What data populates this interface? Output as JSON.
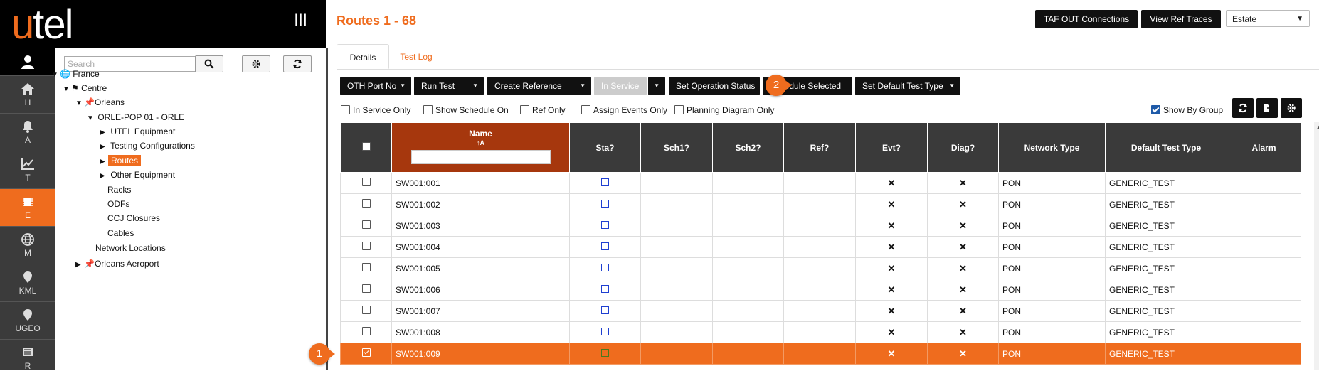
{
  "app": {
    "logo_u": "u",
    "logo_rest": "tel"
  },
  "nav": {
    "items": [
      {
        "label": "H",
        "icon": "home-icon"
      },
      {
        "label": "A",
        "icon": "bell-icon"
      },
      {
        "label": "T",
        "icon": "chart-icon"
      },
      {
        "label": "E",
        "icon": "chip-icon",
        "active": true
      },
      {
        "label": "M",
        "icon": "globe-icon"
      },
      {
        "label": "KML",
        "icon": "map-pin-icon"
      },
      {
        "label": "UGEO",
        "icon": "map-pin-icon"
      },
      {
        "label": "R",
        "icon": "report-icon"
      }
    ]
  },
  "tree": {
    "search_placeholder": "Search",
    "nodes": [
      {
        "label": "France"
      },
      {
        "label": "Centre"
      },
      {
        "label": "Orleans"
      },
      {
        "label": "ORLE-POP 01 - ORLE"
      },
      {
        "label": "UTEL Equipment"
      },
      {
        "label": "Testing Configurations"
      },
      {
        "label": "Routes"
      },
      {
        "label": "Other Equipment"
      },
      {
        "label": "Racks"
      },
      {
        "label": "ODFs"
      },
      {
        "label": "CCJ Closures"
      },
      {
        "label": "Cables"
      },
      {
        "label": "Network Locations"
      },
      {
        "label": "Orleans Aeroport"
      }
    ]
  },
  "header": {
    "title": "Routes 1 - 68",
    "taf_button": "TAF OUT Connections",
    "view_ref_button": "View Ref Traces",
    "estate_value": "Estate"
  },
  "tabs": {
    "details": "Details",
    "test_log": "Test Log"
  },
  "actions": {
    "oth_port": "OTH Port No",
    "run_test": "Run Test",
    "create_ref": "Create Reference",
    "in_service": "In Service",
    "set_op_status": "Set Operation Status",
    "schedule_selected": "Schedule Selected",
    "set_default_test": "Set Default Test Type"
  },
  "filters": {
    "in_service_only": "In Service Only",
    "show_schedule_on": "Show Schedule On",
    "ref_only": "Ref Only",
    "assign_events_only": "Assign Events Only",
    "planning_diagram_only": "Planning Diagram Only",
    "show_by_group": "Show By Group"
  },
  "badges": {
    "one": "1",
    "two": "2"
  },
  "grid": {
    "columns": {
      "name": "Name",
      "sort_icon": "↑A",
      "sta": "Sta?",
      "sch1": "Sch1?",
      "sch2": "Sch2?",
      "ref": "Ref?",
      "evt": "Evt?",
      "diag": "Diag?",
      "network_type": "Network Type",
      "default_test_type": "Default Test Type",
      "alarm": "Alarm"
    },
    "rows": [
      {
        "name": "SW001:001",
        "evt": "✕",
        "diag": "✕",
        "network_type": "PON",
        "test_type": "GENERIC_TEST"
      },
      {
        "name": "SW001:002",
        "evt": "✕",
        "diag": "✕",
        "network_type": "PON",
        "test_type": "GENERIC_TEST"
      },
      {
        "name": "SW001:003",
        "evt": "✕",
        "diag": "✕",
        "network_type": "PON",
        "test_type": "GENERIC_TEST"
      },
      {
        "name": "SW001:004",
        "evt": "✕",
        "diag": "✕",
        "network_type": "PON",
        "test_type": "GENERIC_TEST"
      },
      {
        "name": "SW001:005",
        "evt": "✕",
        "diag": "✕",
        "network_type": "PON",
        "test_type": "GENERIC_TEST"
      },
      {
        "name": "SW001:006",
        "evt": "✕",
        "diag": "✕",
        "network_type": "PON",
        "test_type": "GENERIC_TEST"
      },
      {
        "name": "SW001:007",
        "evt": "✕",
        "diag": "✕",
        "network_type": "PON",
        "test_type": "GENERIC_TEST"
      },
      {
        "name": "SW001:008",
        "evt": "✕",
        "diag": "✕",
        "network_type": "PON",
        "test_type": "GENERIC_TEST"
      },
      {
        "name": "SW001:009",
        "evt": "✕",
        "diag": "✕",
        "network_type": "PON",
        "test_type": "GENERIC_TEST",
        "selected": true
      }
    ]
  },
  "colors": {
    "accent": "#ef6c1e",
    "name_header": "#a6370d",
    "header_dark": "#3a3a3a",
    "nav_bg": "#3b3b3b"
  }
}
